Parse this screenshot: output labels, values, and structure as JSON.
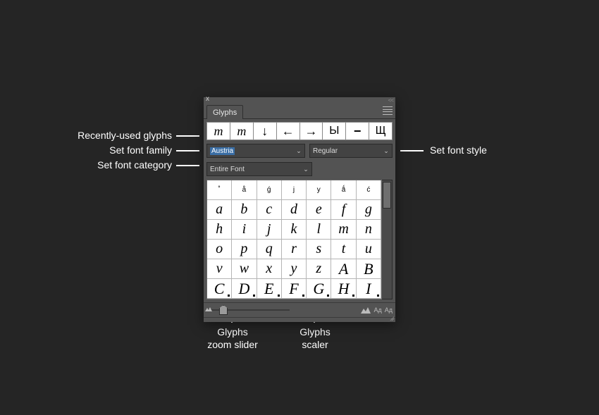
{
  "annotations": {
    "recently_used": "Recently-used glyphs",
    "font_family": "Set font family",
    "font_category": "Set font category",
    "font_style": "Set font style",
    "zoom_slider_l1": "Glyphs",
    "zoom_slider_l2": "zoom slider",
    "scaler_l1": "Glyphs",
    "scaler_l2": "scaler"
  },
  "panel": {
    "close": "x",
    "collapse": "<<",
    "tab": "Glyphs"
  },
  "recent": [
    "m",
    "m",
    "↓",
    "←",
    "→",
    "Ы",
    "−",
    "Щ"
  ],
  "recent_kind": [
    "script",
    "script",
    "arrow",
    "arrow",
    "arrow",
    "text",
    "arrow",
    "text"
  ],
  "selects": {
    "family": "Austria",
    "style": "Regular",
    "category": "Entire Font"
  },
  "grid": [
    [
      "˚",
      "å",
      "ǵ",
      "j",
      "y",
      "ǻ",
      "ć"
    ],
    [
      "a",
      "b",
      "c",
      "d",
      "e",
      "f",
      "g"
    ],
    [
      "h",
      "i",
      "j",
      "k",
      "l",
      "m",
      "n"
    ],
    [
      "o",
      "p",
      "q",
      "r",
      "s",
      "t",
      "u"
    ],
    [
      "v",
      "w",
      "x",
      "y",
      "z",
      "A",
      "B"
    ],
    [
      "C",
      "D",
      "E",
      "F",
      "G",
      "H",
      "I"
    ]
  ],
  "grid_tiny_row": 0,
  "grid_dot_rows": [
    5
  ],
  "scaler": {
    "dec": "Aд",
    "inc": "Aд"
  }
}
